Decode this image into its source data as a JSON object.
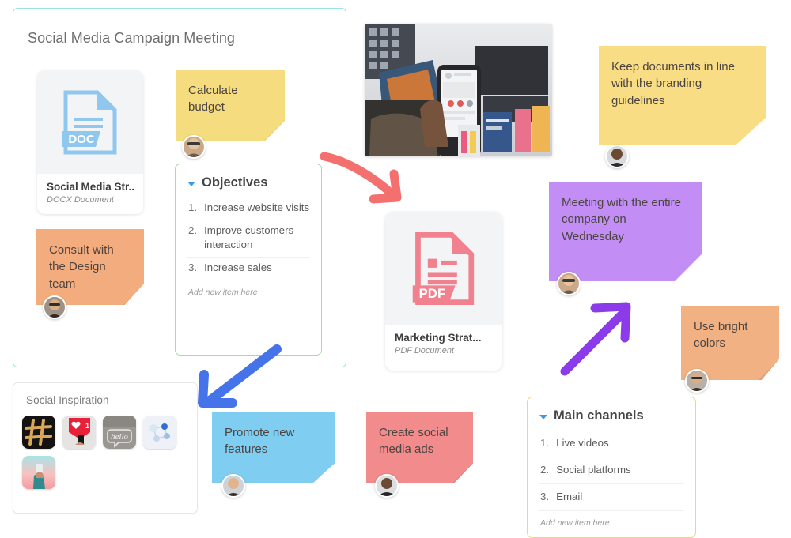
{
  "board": {
    "frames": {
      "main": {
        "title": "Social Media Campaign Meeting",
        "border_color": "#9fe3e0"
      },
      "inspiration": {
        "title": "Social Inspiration",
        "border_color": "#e6e8ea"
      }
    },
    "documents": [
      {
        "id": "docx",
        "name": "Social Media Str...",
        "type": "DOCX Document",
        "badge": "DOC",
        "accent": "#8fc7ef"
      },
      {
        "id": "pdf",
        "name": "Marketing Strat...",
        "type": "PDF Document",
        "badge": "PDF",
        "accent": "#f2818f"
      }
    ],
    "lists": [
      {
        "id": "objectives",
        "title": "Objectives",
        "border_color": "#a6dda0",
        "items": [
          {
            "num": "1.",
            "text": "Increase website visits"
          },
          {
            "num": "2.",
            "text": "Improve customers interaction"
          },
          {
            "num": "3.",
            "text": "Increase sales"
          }
        ],
        "add_new": "Add new item here"
      },
      {
        "id": "channels",
        "title": "Main channels",
        "border_color": "#f2d479",
        "items": [
          {
            "num": "1.",
            "text": "Live videos"
          },
          {
            "num": "2.",
            "text": "Social platforms"
          },
          {
            "num": "3.",
            "text": "Email"
          }
        ],
        "add_new": "Add new item here"
      }
    ],
    "notes": [
      {
        "id": "budget",
        "text": "Calculate\nbudget",
        "color": "#f4dc7f",
        "avatar": "man-glasses"
      },
      {
        "id": "branding",
        "text": "Keep documents in line with the branding guidelines",
        "color": "#f8dd84",
        "avatar": "woman-dark"
      },
      {
        "id": "meeting",
        "text": "Meeting with the entire company on Wednesday",
        "color": "#c28ef5",
        "avatar": "man-glasses"
      },
      {
        "id": "bright",
        "text": "Use bright colors",
        "color": "#f2b182",
        "avatar": "man-beard"
      },
      {
        "id": "consult",
        "text": "Consult with the Design team",
        "color": "#f2ac7e",
        "avatar": "man-beard"
      },
      {
        "id": "promote",
        "text": "Promote new features",
        "color": "#80cdf2",
        "avatar": "man-beard"
      },
      {
        "id": "ads",
        "text": "Create social media ads",
        "color": "#f28b8b",
        "avatar": "woman-dark"
      }
    ],
    "photo": {
      "id": "newsstand-photo",
      "alt": "Hand holding a smartphone in front of a magazine newsstand"
    },
    "thumbnails": [
      {
        "id": "thumb-hashtag",
        "alt": "Golden hashtag on black background"
      },
      {
        "id": "thumb-like",
        "alt": "Red like badge with count 1"
      },
      {
        "id": "thumb-hello",
        "alt": "Hello lettering on grey surface"
      },
      {
        "id": "thumb-network",
        "alt": "Blue social network icons"
      },
      {
        "id": "thumb-phone",
        "alt": "Hand with phone on pink gradient"
      }
    ],
    "arrows": [
      {
        "id": "arrow-red",
        "color": "#f4706e",
        "direction": "down-right"
      },
      {
        "id": "arrow-blue",
        "color": "#4573ea",
        "direction": "down-left"
      },
      {
        "id": "arrow-purple",
        "color": "#8b3ce8",
        "direction": "up-right"
      }
    ]
  }
}
